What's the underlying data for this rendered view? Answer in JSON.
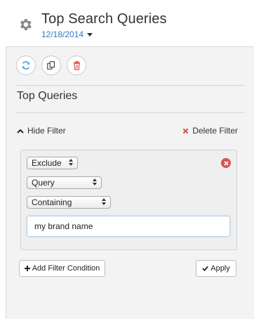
{
  "header": {
    "title": "Top Search Queries",
    "date": "12/18/2014"
  },
  "toolbar": {
    "buttons": [
      {
        "icon": "refresh-icon",
        "color": "#4a9ede"
      },
      {
        "icon": "copy-icon",
        "color": "#444444"
      },
      {
        "icon": "trash-icon",
        "color": "#d9534f"
      }
    ]
  },
  "section": {
    "title": "Top Queries"
  },
  "filter": {
    "hide_label": "Hide Filter",
    "delete_label": "Delete Filter",
    "mode_select": "Exclude",
    "field_select": "Query",
    "operator_select": "Containing",
    "value_input": "my brand name"
  },
  "actions": {
    "add_condition_label": "Add Filter Condition",
    "apply_label": "Apply"
  },
  "colors": {
    "accent": "#2b7bc1",
    "danger": "#d9534f",
    "panel_bg": "#f3f3f3"
  }
}
